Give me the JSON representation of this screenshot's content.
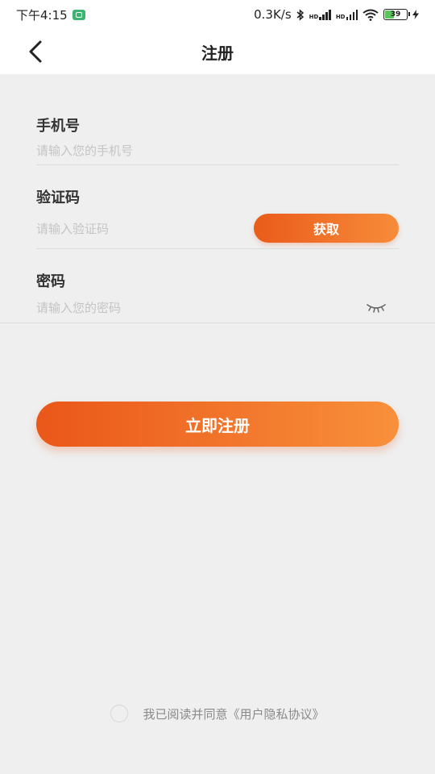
{
  "status_bar": {
    "time": "下午4:15",
    "net_speed": "0.3K/s",
    "battery": "39"
  },
  "nav": {
    "title": "注册"
  },
  "form": {
    "phone_label": "手机号",
    "phone_placeholder": "请输入您的手机号",
    "code_label": "验证码",
    "code_placeholder": "请输入验证码",
    "get_code_label": "获取",
    "password_label": "密码",
    "password_placeholder": "请输入您的密码"
  },
  "register_button": "立即注册",
  "agreement": {
    "text": "我已阅读并同意《用户隐私协议》",
    "checked": false
  },
  "icons": {
    "back": "chevron-left-icon",
    "eye": "eye-closed-icon",
    "bluetooth": "bluetooth-icon",
    "wifi": "wifi-icon",
    "signal": "signal-icon",
    "battery": "battery-icon",
    "charging": "bolt-icon"
  },
  "colors": {
    "accent_start": "#ea5b1a",
    "accent_end": "#f78c3a",
    "background": "#efefef"
  }
}
